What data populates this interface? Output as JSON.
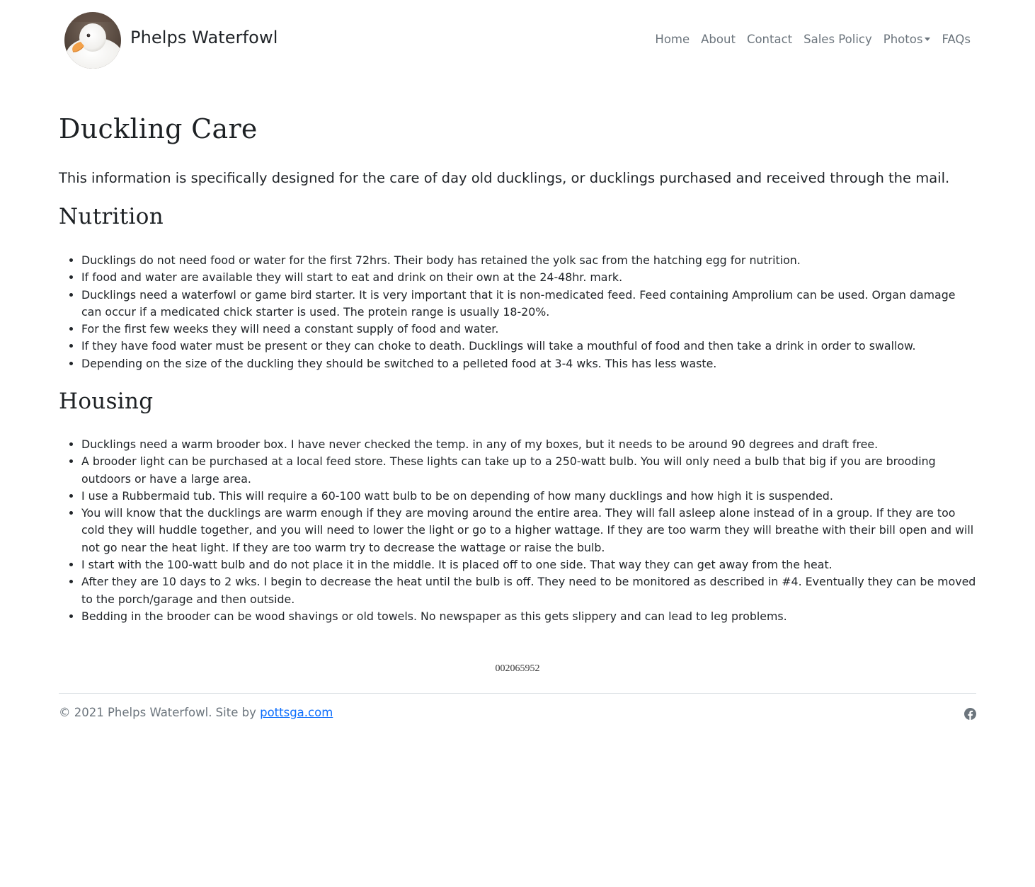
{
  "header": {
    "brand_name": "Phelps Waterfowl",
    "nav": {
      "home": "Home",
      "about": "About",
      "contact": "Contact",
      "sales_policy": "Sales Policy",
      "photos": "Photos",
      "faqs": "FAQs"
    }
  },
  "main": {
    "title": "Duckling Care",
    "intro": "This information is specifically designed for the care of day old ducklings, or ducklings purchased and received through the mail.",
    "sections": [
      {
        "title": "Nutrition",
        "items": [
          "Ducklings do not need food or water for the first 72hrs. Their body has retained the yolk sac from the hatching egg for nutrition.",
          "If food and water are available they will start to eat and drink on their own at the 24-48hr. mark.",
          "Ducklings need a waterfowl or game bird starter. It is very important that it is non-medicated feed. Feed containing Amprolium can be used. Organ damage can occur if a medicated chick starter is used. The protein range is usually 18-20%.",
          "For the first few weeks they will need a constant supply of food and water.",
          "If they have food water must be present or they can choke to death. Ducklings will take a mouthful of food and then take a drink in order to swallow.",
          "Depending on the size of the duckling they should be switched to a pelleted food at 3-4 wks. This has less waste."
        ]
      },
      {
        "title": "Housing",
        "items": [
          "Ducklings need a warm brooder box. I have never checked the temp. in any of my boxes, but it needs to be around 90 degrees and draft free.",
          "A brooder light can be purchased at a local feed store. These lights can take up to a 250-watt bulb. You will only need a bulb that big if you are brooding outdoors or have a large area.",
          "I use a Rubbermaid tub. This will require a 60-100 watt bulb to be on depending of how many ducklings and how high it is suspended.",
          "You will know that the ducklings are warm enough if they are moving around the entire area. They will fall asleep alone instead of in a group. If they are too cold they will huddle together, and you will need to lower the light or go to a higher wattage. If they are too warm they will breathe with their bill open and will not go near the heat light. If they are too warm try to decrease the wattage or raise the bulb.",
          "I start with the 100-watt bulb and do not place it in the middle. It is placed off to one side. That way they can get away from the heat.",
          "After they are 10 days to 2 wks. I begin to decrease the heat until the bulb is off. They need to be monitored as described in #4. Eventually they can be moved to the porch/garage and then outside.",
          "Bedding in the brooder can be wood shavings or old towels. No newspaper as this gets slippery and can lead to leg problems."
        ]
      }
    ],
    "visitor_counter": "002065952"
  },
  "footer": {
    "copyright": "© 2021 Phelps Waterfowl. Site by ",
    "credit_link": "pottsga.com",
    "social_icon": "facebook-icon"
  },
  "colors": {
    "text": "#212529",
    "muted": "#6c757d",
    "link": "#0d6efd",
    "rule": "#dee2e6"
  }
}
